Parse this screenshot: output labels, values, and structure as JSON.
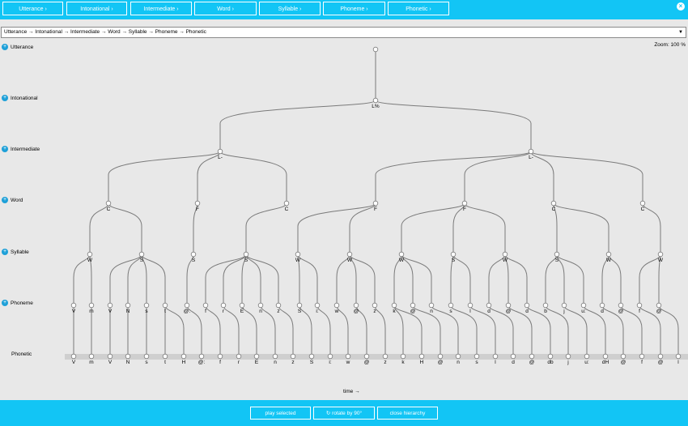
{
  "levels": [
    {
      "name": "Utterance",
      "btn": "Utterance ›"
    },
    {
      "name": "Intonational",
      "btn": "Intonational ›"
    },
    {
      "name": "Intermediate",
      "btn": "Intermediate ›"
    },
    {
      "name": "Word",
      "btn": "Word ›"
    },
    {
      "name": "Syllable",
      "btn": "Syllable ›"
    },
    {
      "name": "Phoneme",
      "btn": "Phoneme ›"
    },
    {
      "name": "Phonetic",
      "btn": "Phonetic ›"
    }
  ],
  "path_select": "Utterance → Intonational → Intermediate → Word → Syllable → Phoneme → Phonetic",
  "zoom_label": "Zoom: 100 %",
  "time_label": "time →",
  "bottom": {
    "play": "play selected",
    "rotate": "↻ rotate by 90°",
    "close": "close hierarchy"
  },
  "colors": {
    "accent": "#12c5f5",
    "plus": "#1ea0d8",
    "edge": "#7a7a7a"
  },
  "tree": {
    "utterance": {
      "label": "",
      "children": [
        0
      ]
    },
    "intonational": [
      {
        "label": "L%",
        "children": [
          0,
          1
        ]
      }
    ],
    "intermediate": [
      {
        "label": "L-",
        "children": [
          0,
          1,
          2
        ]
      },
      {
        "label": "L-",
        "children": [
          3,
          4,
          5,
          6
        ]
      }
    ],
    "word": [
      {
        "label": "C",
        "children": [
          0,
          1
        ]
      },
      {
        "label": "F",
        "children": [
          2
        ]
      },
      {
        "label": "C",
        "children": [
          3
        ]
      },
      {
        "label": "F",
        "children": [
          4,
          5
        ]
      },
      {
        "label": "F",
        "children": [
          6,
          7,
          8
        ]
      },
      {
        "label": "C",
        "children": [
          9,
          10
        ]
      },
      {
        "label": "C",
        "children": [
          11,
          12
        ]
      }
    ],
    "syllable": [
      {
        "label": "W",
        "children": [
          0,
          1
        ]
      },
      {
        "label": "S",
        "children": [
          2,
          3,
          4,
          5
        ]
      },
      {
        "label": "S",
        "children": [
          6
        ]
      },
      {
        "label": "S",
        "children": [
          7,
          8,
          9,
          10,
          11
        ]
      },
      {
        "label": "W",
        "children": [
          12,
          13
        ]
      },
      {
        "label": "W",
        "children": [
          14,
          15,
          16
        ]
      },
      {
        "label": "W",
        "children": [
          17,
          18,
          19
        ]
      },
      {
        "label": "S",
        "children": [
          20,
          21
        ]
      },
      {
        "label": "W",
        "children": [
          22,
          23,
          24
        ]
      },
      {
        "label": "S",
        "children": [
          25,
          26,
          27
        ]
      },
      {
        "label": "W",
        "children": [
          28,
          29
        ]
      },
      {
        "label": "W",
        "children": [
          30,
          31,
          32
        ]
      }
    ],
    "phoneme": [
      "V",
      "m",
      "V",
      "N",
      "s",
      "t",
      "@:",
      "f",
      "r",
      "E",
      "n",
      "z",
      "S",
      "i:",
      "w",
      "@",
      "z",
      "k",
      "@",
      "n",
      "s",
      "l",
      "d",
      "@",
      "d",
      "b",
      "j",
      "u:",
      "d",
      "@",
      "f",
      "@"
    ],
    "phonetic": [
      "V",
      "m",
      "V",
      "N",
      "s",
      "t",
      "H",
      "@:",
      "f",
      "r",
      "E",
      "n",
      "z",
      "S",
      "i:",
      "w",
      "@",
      "z",
      "k",
      "H",
      "@",
      "n",
      "s",
      "l",
      "d",
      "@",
      "db",
      "j",
      "u:",
      "dH",
      "@",
      "f",
      "@",
      "l"
    ],
    "phoneme_to_phonetic": [
      [
        0
      ],
      [
        1
      ],
      [
        2
      ],
      [
        3
      ],
      [
        4
      ],
      [
        5,
        6
      ],
      [
        7
      ],
      [
        8
      ],
      [
        9
      ],
      [
        10
      ],
      [
        11
      ],
      [
        12
      ],
      [
        13
      ],
      [
        14
      ],
      [
        15
      ],
      [
        16
      ],
      [
        17
      ],
      [
        18,
        19
      ],
      [
        20
      ],
      [
        21
      ],
      [
        22
      ],
      [
        23
      ],
      [
        24
      ],
      [
        25
      ],
      [
        26
      ],
      [
        27
      ],
      [
        28
      ],
      [
        29
      ],
      [
        30
      ],
      [
        31
      ],
      [
        32
      ],
      [
        33
      ]
    ]
  }
}
